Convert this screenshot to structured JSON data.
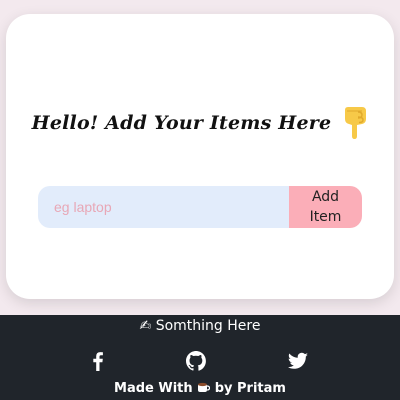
{
  "heading": {
    "text": "Hello! Add Your Items Here"
  },
  "form": {
    "input_value": "",
    "input_placeholder": "eg laptop",
    "add_button_label": "Add Item"
  },
  "footer": {
    "title_prefix": "✍",
    "title": "Somthing Here",
    "social": [
      "facebook-icon",
      "github-icon",
      "twitter-icon"
    ],
    "credit_before": "Made With",
    "credit_after": "by Pritam"
  },
  "colors": {
    "background": "#f3e9ee",
    "card": "#ffffff",
    "input_background": "#e2ecfb",
    "placeholder": "#e8a7b6",
    "button": "#fbaeb8",
    "footer": "#20252b",
    "hand_emoji": "#f7c948"
  }
}
